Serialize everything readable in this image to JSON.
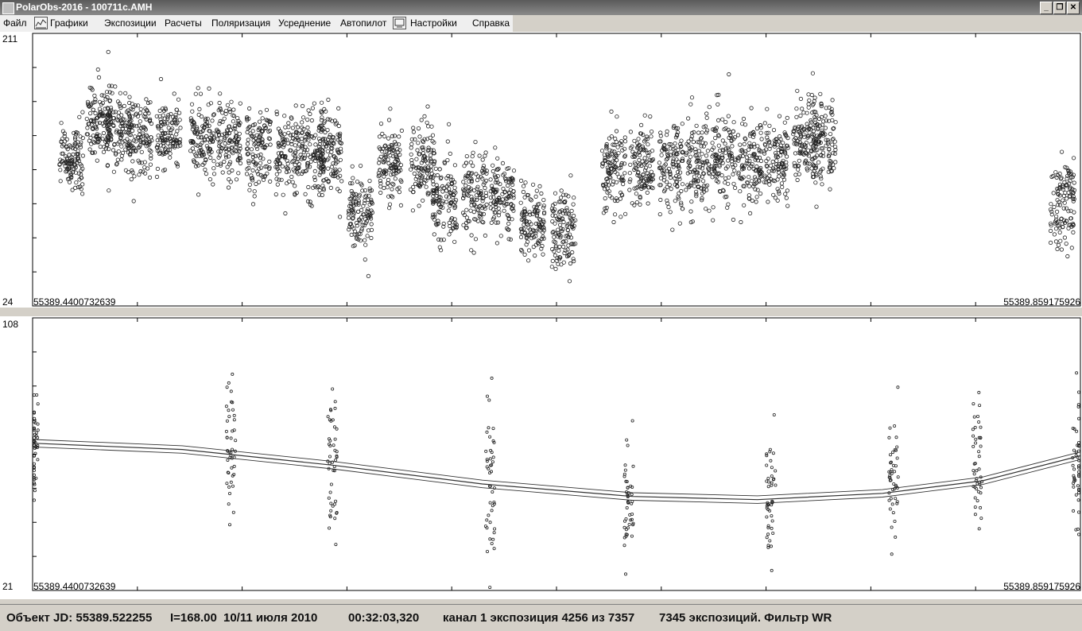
{
  "window": {
    "title": "PolarObs-2016 - 100711c.AMH",
    "controls": {
      "minimize": "_",
      "restore": "❐",
      "close": "✕"
    }
  },
  "menu": [
    {
      "label": "Файл"
    },
    {
      "label": "Графики",
      "icon": "chart-icon"
    },
    {
      "label": "Экспозиции"
    },
    {
      "label": "Расчеты"
    },
    {
      "label": "Поляризация"
    },
    {
      "label": "Усреднение"
    },
    {
      "label": "Автопилот"
    },
    {
      "label": "Настройки",
      "icon": "settings-icon"
    },
    {
      "label": "Справка"
    }
  ],
  "plots": {
    "top": {
      "y_max_label": "211",
      "y_min_label": "24",
      "x_start_label": "55389.4400732639",
      "x_end_label": "55389.859175926"
    },
    "bottom": {
      "y_max_label": "108",
      "y_min_label": "21",
      "x_start_label": "55389.4400732639",
      "x_end_label": "55389.859175926"
    }
  },
  "chart_data": [
    {
      "type": "scatter",
      "xlim": [
        55389.4400732639,
        55389.859175926
      ],
      "ylim": [
        24,
        211
      ],
      "marker": "open-circle",
      "clusters": [
        {
          "x": 55389.4555,
          "y_center": 125,
          "y_spread": 22
        },
        {
          "x": 55389.4665,
          "y_center": 150,
          "y_spread": 22
        },
        {
          "x": 55389.4745,
          "y_center": 148,
          "y_spread": 24
        },
        {
          "x": 55389.483,
          "y_center": 140,
          "y_spread": 24
        },
        {
          "x": 55389.4945,
          "y_center": 140,
          "y_spread": 22
        },
        {
          "x": 55389.508,
          "y_center": 138,
          "y_spread": 24
        },
        {
          "x": 55389.5185,
          "y_center": 135,
          "y_spread": 26
        },
        {
          "x": 55389.5305,
          "y_center": 132,
          "y_spread": 28
        },
        {
          "x": 55389.542,
          "y_center": 128,
          "y_spread": 26
        },
        {
          "x": 55389.552,
          "y_center": 130,
          "y_spread": 28
        },
        {
          "x": 55389.559,
          "y_center": 128,
          "y_spread": 26
        },
        {
          "x": 55389.5712,
          "y_center": 90,
          "y_spread": 22
        },
        {
          "x": 55389.583,
          "y_center": 120,
          "y_spread": 22
        },
        {
          "x": 55389.596,
          "y_center": 122,
          "y_spread": 26
        },
        {
          "x": 55389.605,
          "y_center": 100,
          "y_spread": 26
        },
        {
          "x": 55389.617,
          "y_center": 102,
          "y_spread": 24
        },
        {
          "x": 55389.628,
          "y_center": 98,
          "y_spread": 22
        },
        {
          "x": 55389.64,
          "y_center": 82,
          "y_spread": 22
        },
        {
          "x": 55389.6525,
          "y_center": 76,
          "y_spread": 24
        },
        {
          "x": 55389.6725,
          "y_center": 118,
          "y_spread": 26
        },
        {
          "x": 55389.6835,
          "y_center": 118,
          "y_spread": 26
        },
        {
          "x": 55389.6955,
          "y_center": 120,
          "y_spread": 30
        },
        {
          "x": 55389.706,
          "y_center": 122,
          "y_spread": 30
        },
        {
          "x": 55389.7165,
          "y_center": 124,
          "y_spread": 28
        },
        {
          "x": 55389.727,
          "y_center": 124,
          "y_spread": 26
        },
        {
          "x": 55389.7375,
          "y_center": 125,
          "y_spread": 26
        },
        {
          "x": 55389.749,
          "y_center": 140,
          "y_spread": 24
        },
        {
          "x": 55389.7565,
          "y_center": 136,
          "y_spread": 26
        },
        {
          "x": 55389.852,
          "y_center": 95,
          "y_spread": 26
        }
      ]
    },
    {
      "type": "scatter",
      "xlim": [
        55389.4400732639,
        55389.859175926
      ],
      "ylim": [
        21,
        108
      ],
      "marker": "small-open-circle",
      "clusters": [
        {
          "x": 55389.4405,
          "y_center": 66,
          "y_spread": 18
        },
        {
          "x": 55389.5195,
          "y_center": 68,
          "y_spread": 20
        },
        {
          "x": 55389.56,
          "y_center": 62,
          "y_spread": 22
        },
        {
          "x": 55389.623,
          "y_center": 55,
          "y_spread": 22
        },
        {
          "x": 55389.6785,
          "y_center": 50,
          "y_spread": 20
        },
        {
          "x": 55389.7355,
          "y_center": 52,
          "y_spread": 20
        },
        {
          "x": 55389.7845,
          "y_center": 56,
          "y_spread": 20
        },
        {
          "x": 55389.818,
          "y_center": 62,
          "y_spread": 22
        },
        {
          "x": 55389.858,
          "y_center": 62,
          "y_spread": 20
        }
      ],
      "fit_curve": {
        "x": [
          55389.4400732639,
          55389.5,
          55389.56,
          55389.62,
          55389.68,
          55389.73,
          55389.78,
          55389.82,
          55389.8591
        ],
        "y": [
          68,
          66,
          61,
          55,
          51,
          50,
          52,
          56,
          64
        ],
        "band_offset": 1.2
      }
    }
  ],
  "status": {
    "jd": "Объект JD: 55389.522255",
    "intensity": "I=168.00",
    "date": "10/11 июля 2010",
    "time": "00:32:03,320",
    "exposure": "канал 1 экспозиция 4256 из 7357",
    "total": "7345 экспозиций. Фильтр WR"
  }
}
